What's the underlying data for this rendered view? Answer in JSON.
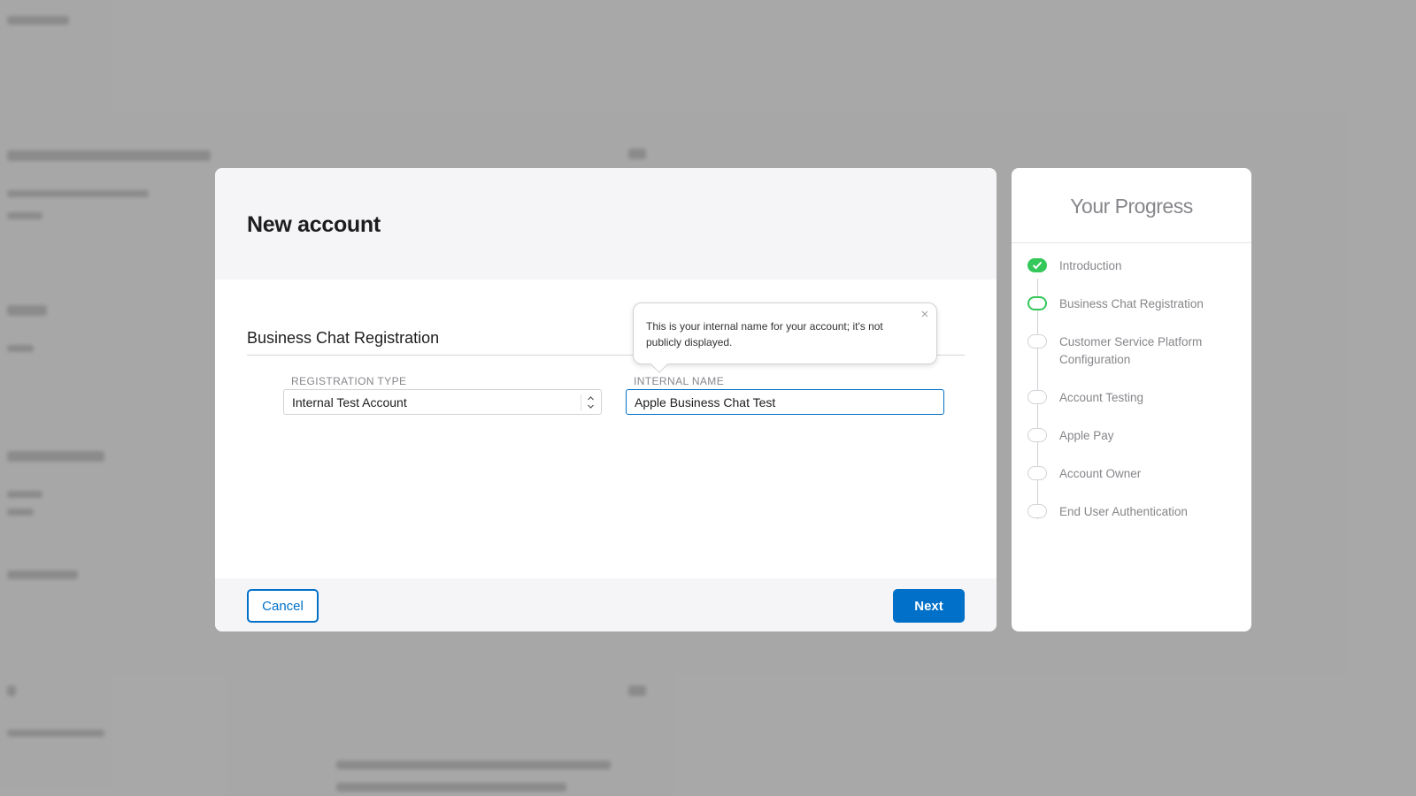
{
  "modal": {
    "title": "New account",
    "section_title": "Business Chat Registration",
    "registration_type": {
      "label": "REGISTRATION TYPE",
      "value": "Internal Test Account"
    },
    "internal_name": {
      "label": "INTERNAL NAME",
      "value": "Apple Business Chat Test"
    },
    "tooltip": {
      "text": "This is your internal name for your account; it's not publicly displayed."
    },
    "footer": {
      "cancel_label": "Cancel",
      "next_label": "Next"
    }
  },
  "progress": {
    "title": "Your Progress",
    "steps": [
      {
        "label": "Introduction",
        "status": "done"
      },
      {
        "label": "Business Chat Registration",
        "status": "current"
      },
      {
        "label": "Customer Service Platform Configuration",
        "status": "pending"
      },
      {
        "label": "Account Testing",
        "status": "pending"
      },
      {
        "label": "Apple Pay",
        "status": "pending"
      },
      {
        "label": "Account Owner",
        "status": "pending"
      },
      {
        "label": "End User Authentication",
        "status": "pending"
      }
    ]
  },
  "colors": {
    "accent": "#0070c9",
    "success": "#34c759",
    "overlay": "rgba(0,0,0,0.33)"
  },
  "icons": {
    "tooltip_close": "close-icon",
    "select_arrows": "chevron-up-down-icon",
    "step_done": "checkmark-icon"
  }
}
